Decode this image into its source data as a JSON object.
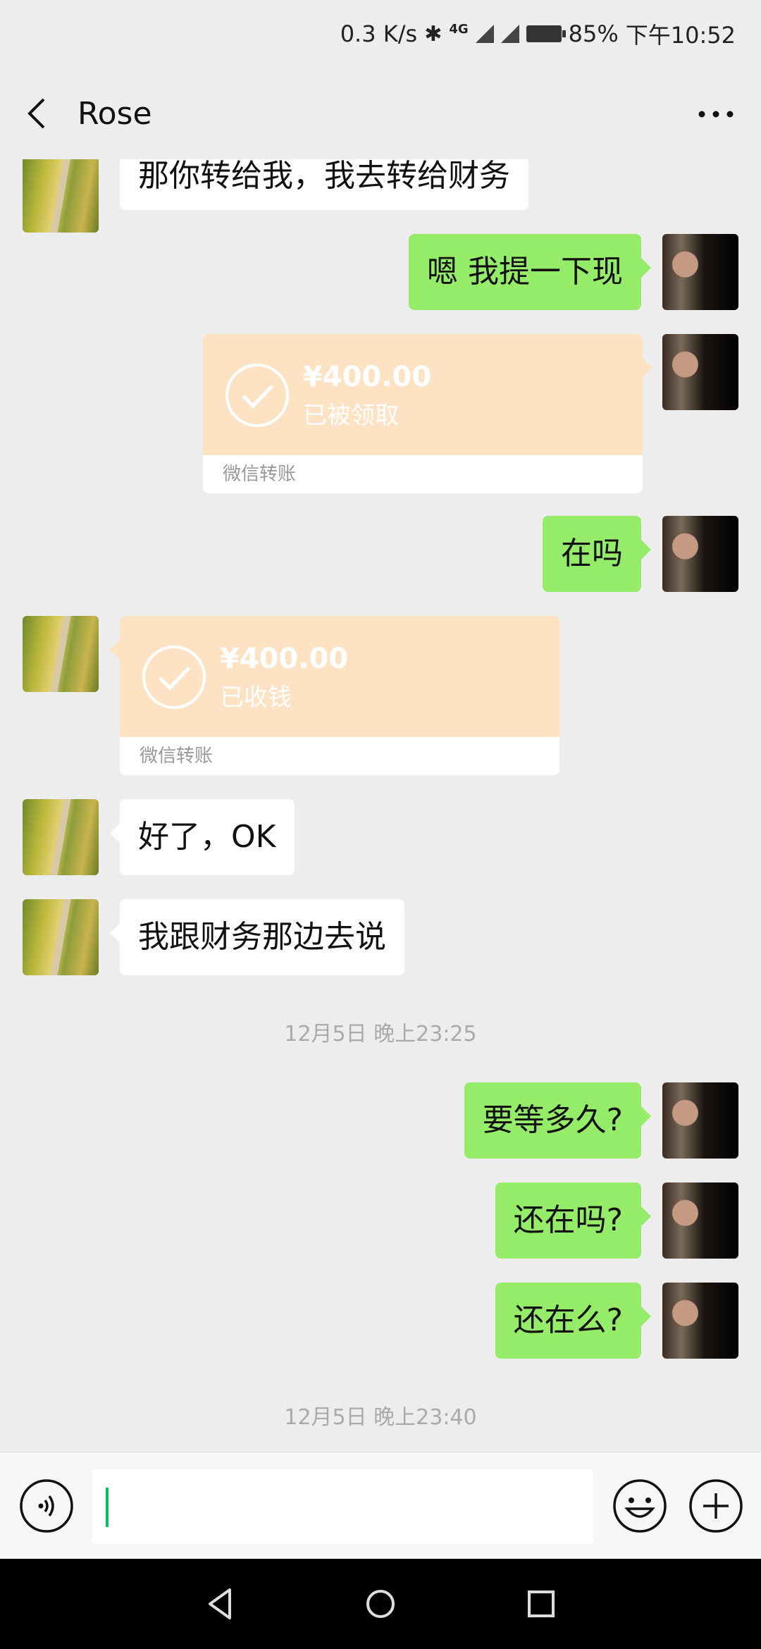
{
  "status_bar": {
    "speed": "0.3 K/s",
    "network": "4G",
    "battery": "85%",
    "time": "下午10:52"
  },
  "header": {
    "title": "Rose"
  },
  "messages": [
    {
      "side": "left",
      "text": "那你转给我，我去转给财务"
    },
    {
      "side": "right",
      "text": "嗯  我提一下现"
    },
    {
      "side": "right",
      "type": "transfer",
      "amount": "¥400.00",
      "status": "已被领取",
      "footer": "微信转账"
    },
    {
      "side": "right",
      "text": "在吗"
    },
    {
      "side": "left",
      "type": "transfer",
      "amount": "¥400.00",
      "status": "已收钱",
      "footer": "微信转账"
    },
    {
      "side": "left",
      "text": "好了，OK"
    },
    {
      "side": "left",
      "text": "我跟财务那边去说"
    },
    {
      "type": "time",
      "text": "12月5日 晚上23:25"
    },
    {
      "side": "right",
      "text": "要等多久?"
    },
    {
      "side": "right",
      "text": "还在吗?"
    },
    {
      "side": "right",
      "text": "还在么?"
    },
    {
      "type": "time",
      "text": "12月5日 晚上23:40"
    }
  ],
  "colors": {
    "accent_green": "#95ec69",
    "transfer_card": "#fde2c4",
    "cursor": "#07c160"
  }
}
